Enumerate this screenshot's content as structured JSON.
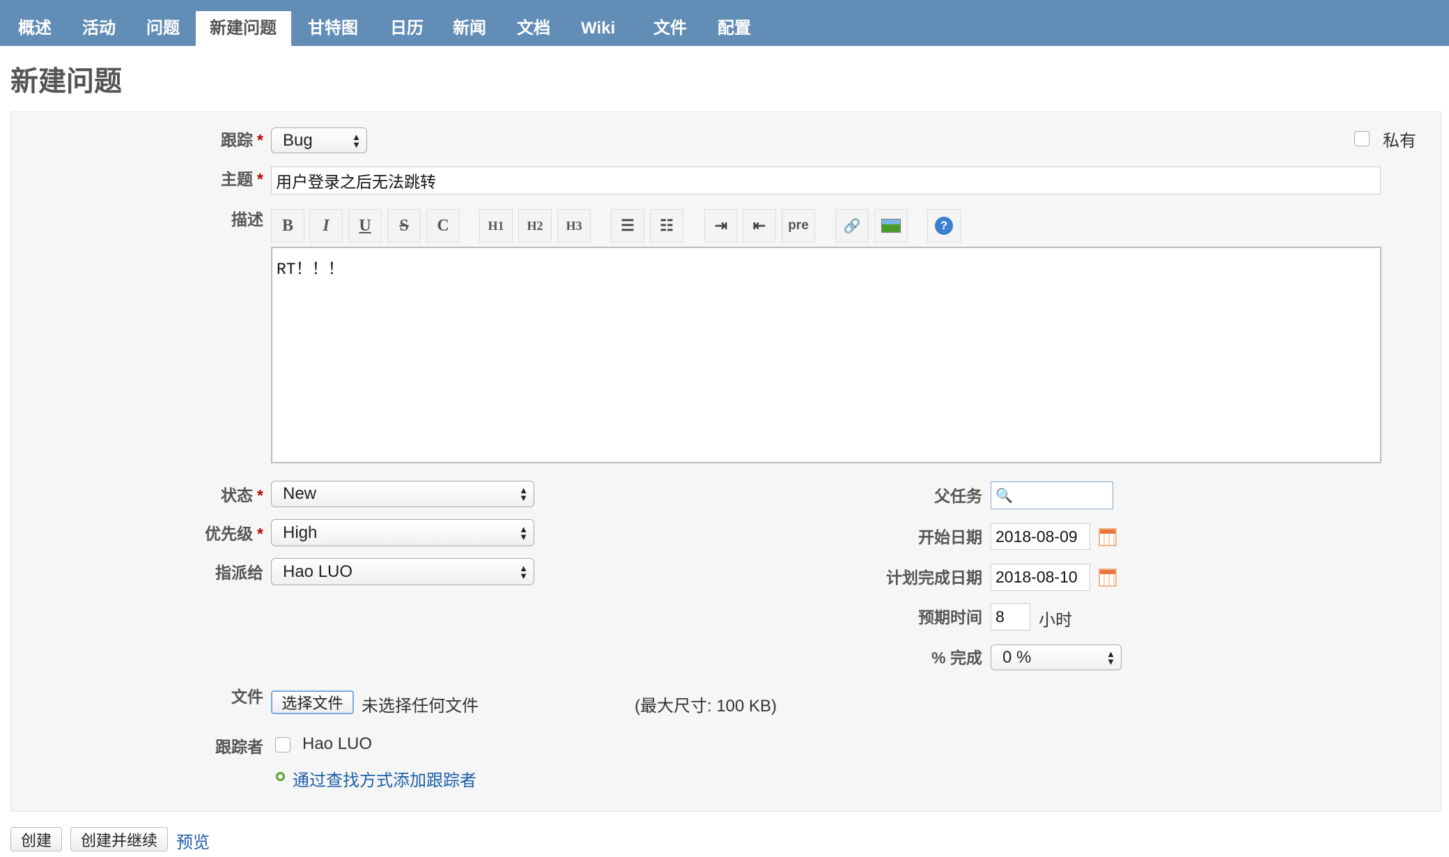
{
  "nav": {
    "tabs": [
      "概述",
      "活动",
      "问题",
      "新建问题",
      "甘特图",
      "日历",
      "新闻",
      "文档",
      "Wiki",
      "文件",
      "配置"
    ],
    "selected": "新建问题"
  },
  "page_title": "新建问题",
  "form": {
    "tracker": {
      "label": "跟踪",
      "value": "Bug"
    },
    "private": {
      "label": "私有",
      "checked": false
    },
    "subject": {
      "label": "主题",
      "value": "用户登录之后无法跳转"
    },
    "description": {
      "label": "描述",
      "value": "RT！！！",
      "toolbar": [
        "B",
        "I",
        "U",
        "S",
        "C",
        "H1",
        "H2",
        "H3",
        "ul",
        "ol",
        "indent",
        "outdent",
        "pre",
        "link",
        "image",
        "help"
      ]
    },
    "status": {
      "label": "状态",
      "value": "New"
    },
    "priority": {
      "label": "优先级",
      "value": "High"
    },
    "assignee": {
      "label": "指派给",
      "value": "Hao LUO"
    },
    "parent": {
      "label": "父任务",
      "value": ""
    },
    "start_date": {
      "label": "开始日期",
      "value": "2018-08-09"
    },
    "due_date": {
      "label": "计划完成日期",
      "value": "2018-08-10"
    },
    "estimated": {
      "label": "预期时间",
      "value": "8",
      "unit": "小时"
    },
    "done": {
      "label": "% 完成",
      "value": "0 %"
    },
    "files": {
      "label": "文件",
      "button": "选择文件",
      "status": "未选择任何文件",
      "max": "(最大尺寸: 100 KB)"
    },
    "watchers": {
      "label": "跟踪者",
      "user": "Hao LUO",
      "add_link": "通过查找方式添加跟踪者"
    },
    "required_mark": "*"
  },
  "actions": {
    "create": "创建",
    "create_continue": "创建并继续",
    "preview": "预览"
  }
}
